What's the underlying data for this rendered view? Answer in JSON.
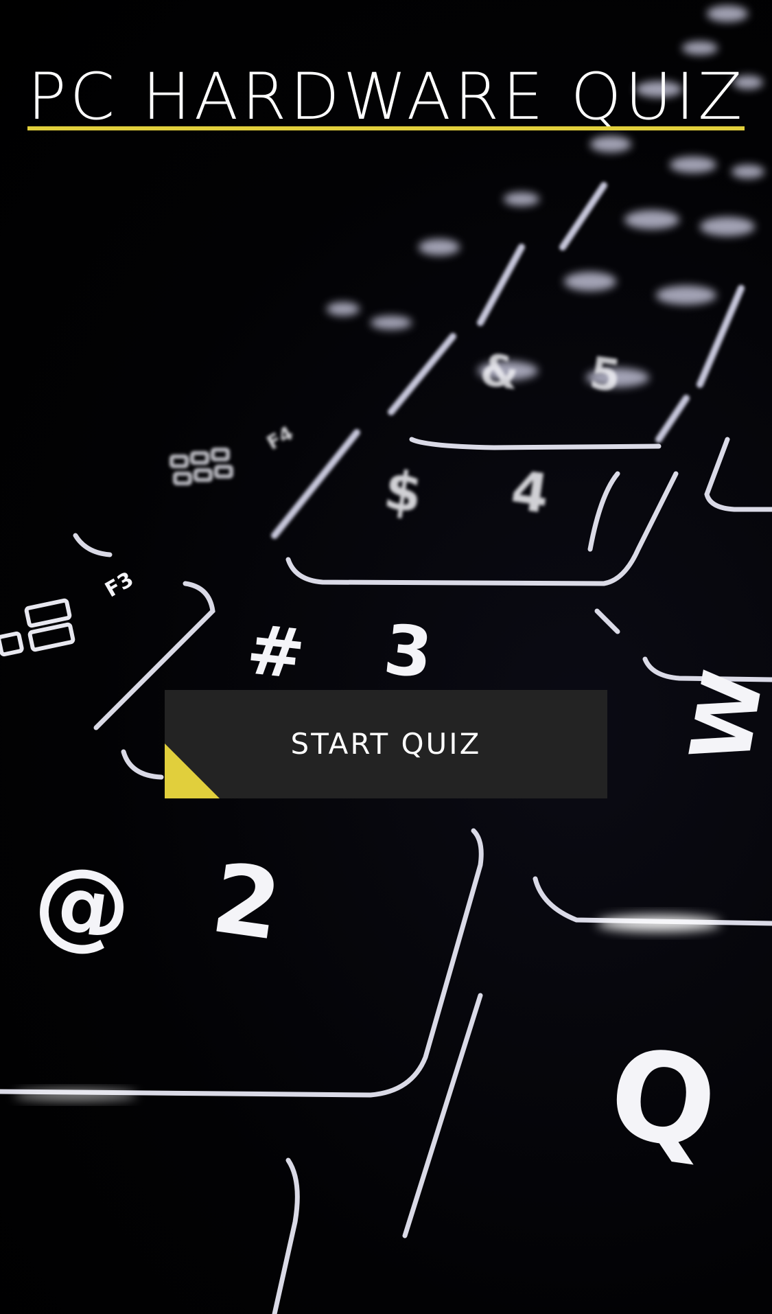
{
  "header": {
    "title": "PC HARDWARE QUIZ"
  },
  "main": {
    "start_button_label": "START QUIZ"
  },
  "colors": {
    "accent": "#e1cf3c",
    "button_bg": "#232323",
    "text": "#ffffff",
    "background": "#000000"
  },
  "background_image": {
    "keycap_legends": [
      "$",
      "4",
      "#",
      "3",
      "@",
      "2",
      "&",
      "5",
      "W",
      "Q",
      "F3",
      "F4"
    ]
  }
}
